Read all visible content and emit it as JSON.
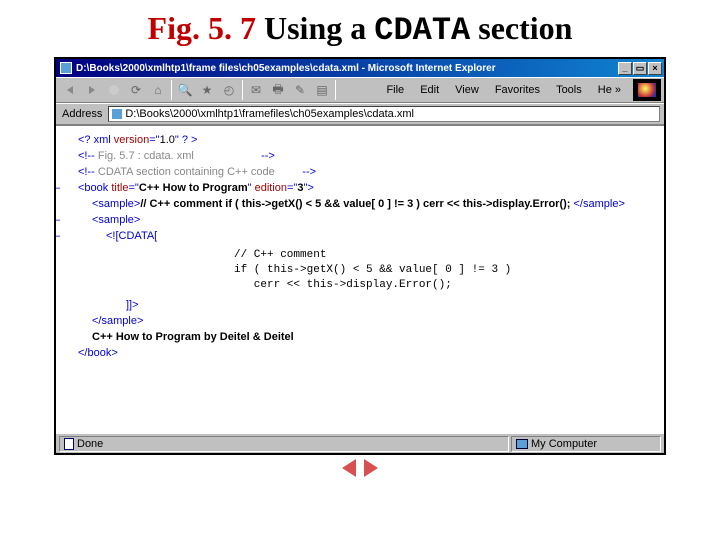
{
  "heading": {
    "fig_prefix": "Fig. 5. 7",
    "spacer": "   ",
    "text1": "Using a ",
    "cdata": "CDATA",
    "text2": " section"
  },
  "window": {
    "title": "D:\\Books\\2000\\xmlhtp1\\frame files\\ch05examples\\cdata.xml - Microsoft Internet Explorer",
    "min": "_",
    "max": "▭",
    "close": "×"
  },
  "menu": {
    "file": "File",
    "edit": "Edit",
    "view": "View",
    "favorites": "Favorites",
    "tools": "Tools",
    "help": "He",
    "more": "»"
  },
  "address": {
    "label": "Address",
    "value": "D:\\Books\\2000\\xmlhtp1\\framefiles\\ch05examples\\cdata.xml"
  },
  "xml": {
    "l1a": "<? xml ",
    "l1b": "version",
    "l1c": "=\"",
    "l1d": "1.0",
    "l1e": "\" ? >",
    "l2a": "<!-- ",
    "l2b": "Fig. 5.7 : cdata. xml",
    "l2pad": "                     ",
    "l2c": " -->",
    "l3a": "<!-- ",
    "l3b": "CDATA section containing C++ code",
    "l3pad": "        ",
    "l3c": " -->",
    "l4a": "<book ",
    "l4b": "title",
    "l4c": "=\"",
    "l4d": "C++ How to Program",
    "l4e": "\" ",
    "l4f": "edition",
    "l4g": "=\"",
    "l4h": "3",
    "l4i": "\">",
    "l5a": "<sample>",
    "l5b": "// C++ comment if ( this->getX() < 5 && value[ 0 ] != 3 ) cerr << this->display.Error();",
    "l5c": " </sample>",
    "l6": "<sample>",
    "l7": "<![CDATA[",
    "code1": "// C++ comment",
    "code2": "if ( this->getX() < 5 && value[ 0 ] != 3 )",
    "code3": "   cerr << this->display.Error();",
    "l8": "]]>",
    "l9": "</sample>",
    "l10": "C++ How to Program by Deitel & Deitel",
    "l11": "</book>"
  },
  "status": {
    "done": "Done",
    "zone": "My Computer"
  }
}
